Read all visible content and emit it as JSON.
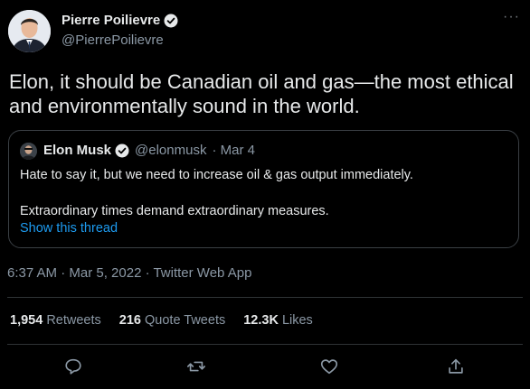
{
  "author": {
    "display_name": "Pierre Poilievre",
    "handle": "@PierrePoilievre",
    "verified": true
  },
  "tweet": {
    "text": "Elon, it should be Canadian oil and gas—the most ethical and environmentally sound in the world.",
    "timestamp": "6:37 AM · Mar 5, 2022 · Twitter Web App"
  },
  "quoted_tweet": {
    "display_name": "Elon Musk",
    "handle": "@elonmusk",
    "date": "· Mar 4",
    "verified": true,
    "paragraph_1": "Hate to say it, but we need to increase oil & gas output immediately.",
    "paragraph_2": "Extraordinary times demand extraordinary measures.",
    "link_text": "Show this thread"
  },
  "stats": {
    "retweets_count": "1,954",
    "retweets_label": "Retweets",
    "quotes_count": "216",
    "quotes_label": "Quote Tweets",
    "likes_count": "12.3K",
    "likes_label": "Likes"
  },
  "more_menu": "···",
  "icons": [
    "reply-icon",
    "retweet-icon",
    "like-icon",
    "share-icon",
    "verified-icon",
    "more-icon"
  ],
  "colors": {
    "background": "#000000",
    "text": "#e7e9ea",
    "secondary": "#8b98a5",
    "link": "#1d9bf0",
    "verified": "#1d9bf0"
  }
}
